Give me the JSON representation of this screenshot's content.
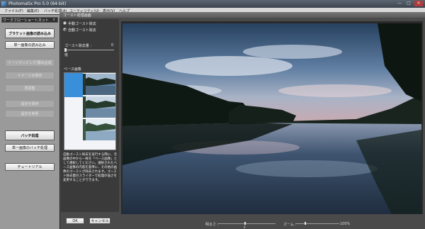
{
  "app": {
    "title": "Photomatix Pro 5.0 (64-bit)"
  },
  "window_controls": {
    "minimize": "—",
    "maximize": "□",
    "close": "✕"
  },
  "menubar": [
    "ファイル(F)",
    "編集(E)",
    "バッチ処理(A)",
    "ユーティリティ(U)",
    "表示(V)",
    "ヘルプ"
  ],
  "shortcuts": {
    "title": "ワークフローショートカット",
    "close": "×",
    "buttons": [
      {
        "label": "ブラケット画像の読み込み",
        "state": "on"
      },
      {
        "label": "単一画像の読み込み",
        "state": "on"
      },
      {
        "label": "トーンマッピング/露出合成",
        "state": "off"
      },
      {
        "label": "イメージの保存",
        "state": "off"
      },
      {
        "label": "再調整",
        "state": "off"
      },
      {
        "label": "設定を保存",
        "state": "off"
      },
      {
        "label": "設定を参照",
        "state": "off"
      },
      {
        "label": "バッチ処理",
        "state": "on"
      },
      {
        "label": "単一画像のバッチ処理",
        "state": "on"
      },
      {
        "label": "チュートリアル",
        "state": "on"
      }
    ]
  },
  "dialog": {
    "title": "ゴースト処理画面",
    "mode_options": [
      {
        "label": "手動ゴースト除去",
        "selected": false
      },
      {
        "label": "自動ゴースト除去",
        "selected": true
      }
    ],
    "strength": {
      "label": "ゴースト除去量 :",
      "value": "0",
      "min_label": "低"
    },
    "base_image_label": "ベース画像",
    "description": "自動ゴースト除去を実行する際に、元画像の中から一枚を「ベース画像」として選択してください。選択されたベース画像の内容を基準に、その他の画像のゴーストが除去されます。ゴースト除去量のスライダーで処理の強さを変更することができます。",
    "ok_label": "OK",
    "cancel_label": "キャンセル",
    "brightness": {
      "label": "明るさ :",
      "value": "0"
    },
    "zoom": {
      "label": "ズーム :",
      "value": "100%"
    }
  }
}
